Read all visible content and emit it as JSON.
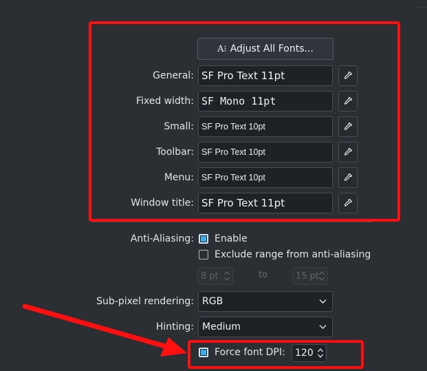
{
  "adjust_button": {
    "icon": "font-adjust-icon",
    "glyph": "A⁝",
    "label": "Adjust All Fonts..."
  },
  "fonts": [
    {
      "key": "general",
      "label": "General:",
      "value": "SF Pro Text 11pt",
      "style": "lg"
    },
    {
      "key": "fixed-width",
      "label": "Fixed width:",
      "value": "SF Mono 11pt",
      "style": "mono"
    },
    {
      "key": "small",
      "label": "Small:",
      "value": "SF Pro Text 10pt",
      "style": "sm"
    },
    {
      "key": "toolbar",
      "label": "Toolbar:",
      "value": "SF Pro Text 10pt",
      "style": "sm"
    },
    {
      "key": "menu",
      "label": "Menu:",
      "value": "SF Pro Text 10pt",
      "style": "sm"
    },
    {
      "key": "window-title",
      "label": "Window title:",
      "value": "SF Pro Text 11pt",
      "style": "lg"
    }
  ],
  "anti_aliasing": {
    "label": "Anti-Aliasing:",
    "enable_label": "Enable",
    "enable_checked": true,
    "exclude_label": "Exclude range from anti-aliasing",
    "exclude_checked": false,
    "range_from": "8 pt",
    "range_to_label": "to",
    "range_to": "15 pt"
  },
  "subpixel": {
    "label": "Sub-pixel rendering:",
    "value": "RGB"
  },
  "hinting": {
    "label": "Hinting:",
    "value": "Medium"
  },
  "force_dpi": {
    "label": "Force font DPI:",
    "checked": true,
    "value": "120"
  },
  "colors": {
    "background": "#2b2e33",
    "field": "#1e2125",
    "accent": "#3daee9",
    "highlight": "#ff1010"
  }
}
